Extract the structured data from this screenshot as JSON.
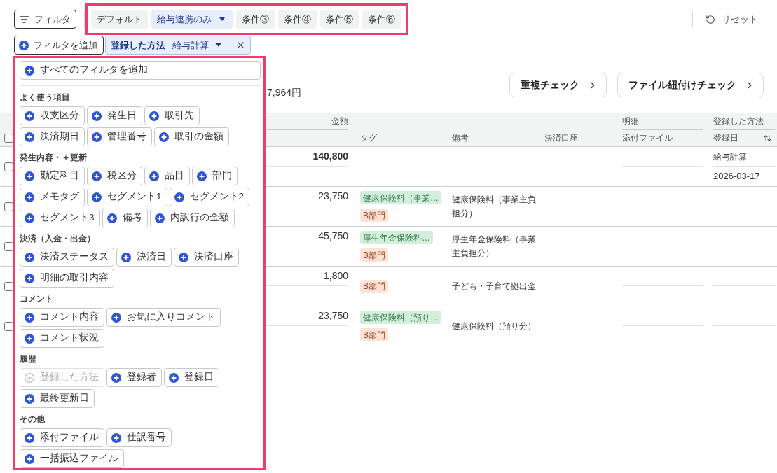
{
  "toolbar": {
    "filter_button": "フィルタ",
    "presets": [
      {
        "label": "デフォルト",
        "selected": false
      },
      {
        "label": "給与連携のみ",
        "selected": true
      },
      {
        "label": "条件③",
        "selected": false
      },
      {
        "label": "条件④",
        "selected": false
      },
      {
        "label": "条件⑤",
        "selected": false
      },
      {
        "label": "条件⑥",
        "selected": false
      }
    ],
    "reset_button": "リセット"
  },
  "active_filters": {
    "add_button": "フィルタを追加",
    "chips": [
      {
        "field": "登録した方法",
        "value": "給与計算"
      }
    ]
  },
  "filter_menu": {
    "add_all_button": "すべてのフィルタを追加",
    "groups": [
      {
        "heading": "よく使う項目",
        "items": [
          {
            "label": "収支区分",
            "disabled": false
          },
          {
            "label": "発生日",
            "disabled": false
          },
          {
            "label": "取引先",
            "disabled": false
          },
          {
            "label": "決済期日",
            "disabled": false
          },
          {
            "label": "管理番号",
            "disabled": false
          },
          {
            "label": "取引の金額",
            "disabled": false
          }
        ]
      },
      {
        "heading": "発生内容・＋更新",
        "items": [
          {
            "label": "勘定科目",
            "disabled": false
          },
          {
            "label": "税区分",
            "disabled": false
          },
          {
            "label": "品目",
            "disabled": false
          },
          {
            "label": "部門",
            "disabled": false
          },
          {
            "label": "メモタグ",
            "disabled": false
          },
          {
            "label": "セグメント1",
            "disabled": false
          },
          {
            "label": "セグメント2",
            "disabled": false
          },
          {
            "label": "セグメント3",
            "disabled": false
          },
          {
            "label": "備考",
            "disabled": false
          },
          {
            "label": "内訳行の金額",
            "disabled": false
          }
        ]
      },
      {
        "heading": "決済（入金・出金）",
        "items": [
          {
            "label": "決済ステータス",
            "disabled": false
          },
          {
            "label": "決済日",
            "disabled": false
          },
          {
            "label": "決済口座",
            "disabled": false
          },
          {
            "label": "明細の取引内容",
            "disabled": false
          }
        ]
      },
      {
        "heading": "コメント",
        "items": [
          {
            "label": "コメント内容",
            "disabled": false
          },
          {
            "label": "お気に入りコメント",
            "disabled": false
          },
          {
            "label": "コメント状況",
            "disabled": false
          }
        ]
      },
      {
        "heading": "履歴",
        "items": [
          {
            "label": "登録した方法",
            "disabled": true
          },
          {
            "label": "登録者",
            "disabled": false
          },
          {
            "label": "登録日",
            "disabled": false
          },
          {
            "label": "最終更新日",
            "disabled": false
          }
        ]
      },
      {
        "heading": "その他",
        "items": [
          {
            "label": "添付ファイル",
            "disabled": false
          },
          {
            "label": "仕訳番号",
            "disabled": false
          },
          {
            "label": "一括振込ファイル",
            "disabled": false
          }
        ]
      }
    ]
  },
  "summary": {
    "total": "7,964円"
  },
  "check_buttons": [
    "重複チェック",
    "ファイル紐付けチェック"
  ],
  "table": {
    "all_checked": false,
    "columns": [
      {
        "kind": "amount",
        "group": "金額",
        "sortable": false
      },
      {
        "kind": "tags",
        "label": "タグ",
        "sortable": false
      },
      {
        "kind": "note",
        "label": "備考",
        "sortable": false
      },
      {
        "kind": "account",
        "label": "決済口座",
        "sortable": false
      },
      {
        "kind": "attachment",
        "group": "明細",
        "label": "添付ファイル",
        "sortable": false
      },
      {
        "kind": "registration",
        "group": "登録した方法",
        "label": "登録日",
        "sortable": true
      }
    ],
    "rows": [
      {
        "kind": "summary",
        "checked": false,
        "amount": "140,800",
        "method": "給与計算",
        "registered_on": "2026-03-17"
      },
      {
        "kind": "detail",
        "checked": false,
        "amount": "23,750",
        "tags": [
          {
            "label": "健康保険料（事業…",
            "kind": "item",
            "color": "#d4eedc"
          },
          {
            "label": "B部門",
            "kind": "department",
            "color": "#fde2d6"
          }
        ],
        "note": "健康保険料（事業主負担分）"
      },
      {
        "kind": "detail",
        "checked": false,
        "amount": "45,750",
        "tags": [
          {
            "label": "厚生年金保険料…",
            "kind": "item",
            "color": "#d4eedc"
          },
          {
            "label": "B部門",
            "kind": "department",
            "color": "#fde2d6"
          }
        ],
        "note": "厚生年金保険料（事業主負担分）"
      },
      {
        "kind": "detail",
        "checked": false,
        "amount": "1,800",
        "tags": [
          {
            "label": "B部門",
            "kind": "department",
            "color": "#fde2d6"
          }
        ],
        "note": "子ども・子育て拠出金"
      },
      {
        "kind": "detail",
        "checked": false,
        "amount": "23,750",
        "tags": [
          {
            "label": "健康保険料（預り…",
            "kind": "item",
            "color": "#d4eedc"
          },
          {
            "label": "B部門",
            "kind": "department",
            "color": "#fde2d6"
          }
        ],
        "note": "健康保険料（預り分）"
      }
    ]
  }
}
